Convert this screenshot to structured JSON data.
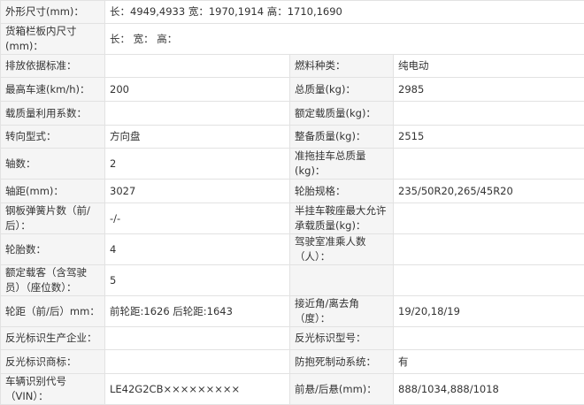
{
  "rows": [
    {
      "type": "full",
      "label": "外形尺寸(mm)",
      "value": "长：4949,4933 宽：1970,1914 高：1710,1690"
    },
    {
      "type": "full",
      "label": "货箱栏板内尺寸(mm)",
      "value": "长：  宽：  高："
    },
    {
      "type": "pair",
      "l1": "排放依据标准",
      "v1": "",
      "l2": "燃料种类",
      "v2": "纯电动"
    },
    {
      "type": "pair",
      "l1": "最高车速(km/h)",
      "v1": "200",
      "l2": "总质量(kg)",
      "v2": "2985"
    },
    {
      "type": "pair",
      "l1": "载质量利用系数",
      "v1": "",
      "l2": "额定载质量(kg)",
      "v2": ""
    },
    {
      "type": "pair",
      "l1": "转向型式",
      "v1": "方向盘",
      "l2": "整备质量(kg)",
      "v2": "2515"
    },
    {
      "type": "pair",
      "l1": "轴数",
      "v1": "2",
      "l2": "准拖挂车总质量(kg)",
      "v2": ""
    },
    {
      "type": "pair",
      "l1": "轴距(mm)",
      "v1": "3027",
      "l2": "轮胎规格",
      "v2": "235/50R20,265/45R20"
    },
    {
      "type": "pair",
      "l1": "钢板弹簧片数（前/后）",
      "v1": "-/-",
      "l2": "半挂车鞍座最大允许承载质量(kg)",
      "v2": ""
    },
    {
      "type": "pair",
      "l1": "轮胎数",
      "v1": "4",
      "l2": "驾驶室准乘人数（人）",
      "v2": ""
    },
    {
      "type": "pair",
      "l1": "额定载客（含驾驶员）（座位数）",
      "v1": "5",
      "l2": "",
      "v2": ""
    },
    {
      "type": "pair",
      "l1": "轮距（前/后）mm",
      "v1": "前轮距:1626 后轮距:1643",
      "l2": "接近角/离去角（度）",
      "v2": "19/20,18/19"
    },
    {
      "type": "pair",
      "l1": "反光标识生产企业",
      "v1": "",
      "l2": "反光标识型号",
      "v2": ""
    },
    {
      "type": "pair",
      "l1": "反光标识商标",
      "v1": "",
      "l2": "防抱死制动系统",
      "v2": "有"
    },
    {
      "type": "pair",
      "l1": "车辆识别代号（VIN）",
      "v1": "LE42G2CB×××××××××",
      "l2": "前悬/后悬(mm)",
      "v2": "888/1034,888/1018"
    }
  ]
}
